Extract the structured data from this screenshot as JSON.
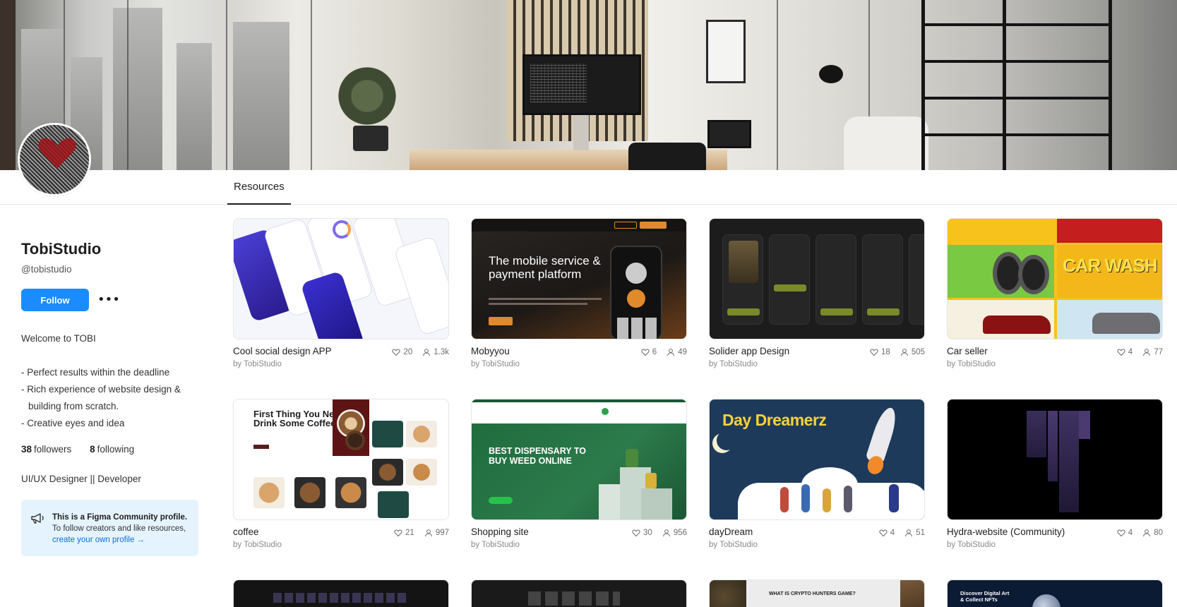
{
  "tabs": [
    {
      "label": "Resources",
      "active": true
    }
  ],
  "profile": {
    "name": "TobiStudio",
    "handle": "@tobistudio",
    "follow_label": "Follow",
    "more_label": "•••",
    "bio": {
      "welcome": "Welcome to TOBI",
      "points": [
        "- Perfect results within the deadline",
        "- Rich experience of website design & building from scratch.",
        "- Creative eyes and idea"
      ]
    },
    "followers_count": "38",
    "followers_label": "followers",
    "following_count": "8",
    "following_label": "following",
    "role": "UI/UX Designer || Developer",
    "community_box": {
      "title": "This is a Figma Community profile.",
      "text": "To follow creators and like resources,",
      "link": "create your own profile →"
    }
  },
  "resources": [
    {
      "title": "Cool social design APP",
      "author": "by TobiStudio",
      "likes": "20",
      "users": "1.3k"
    },
    {
      "title": "Mobyyou",
      "author": "by TobiStudio",
      "likes": "6",
      "users": "49",
      "thumb_text": "The mobile service & payment platform"
    },
    {
      "title": "Solider app Design",
      "author": "by TobiStudio",
      "likes": "18",
      "users": "505"
    },
    {
      "title": "Car seller",
      "author": "by TobiStudio",
      "likes": "4",
      "users": "77",
      "thumb_text": "CAR WASH"
    },
    {
      "title": "coffee",
      "author": "by TobiStudio",
      "likes": "21",
      "users": "997",
      "thumb_text": "First Thing You Need Drink Some Coffee."
    },
    {
      "title": "Shopping site",
      "author": "by TobiStudio",
      "likes": "30",
      "users": "956",
      "thumb_text": "BEST DISPENSARY TO BUY WEED ONLINE"
    },
    {
      "title": "dayDream",
      "author": "by TobiStudio",
      "likes": "4",
      "users": "51",
      "thumb_text": "Day Dreamerz"
    },
    {
      "title": "Hydra-website (Community)",
      "author": "by TobiStudio",
      "likes": "4",
      "users": "80"
    },
    {
      "title": "",
      "author": "",
      "likes": "",
      "users": ""
    },
    {
      "title": "",
      "author": "",
      "likes": "",
      "users": ""
    },
    {
      "title": "",
      "author": "",
      "likes": "",
      "users": "",
      "thumb_text": "WHAT IS CRYPTO HUNTERS GAME?"
    },
    {
      "title": "",
      "author": "",
      "likes": "",
      "users": "",
      "thumb_text": "Discover Digital Art & Collect NFTs"
    }
  ],
  "colors": {
    "accent": "#1a8cff",
    "community_bg": "#e5f3ff",
    "link": "#0d6fd6"
  }
}
